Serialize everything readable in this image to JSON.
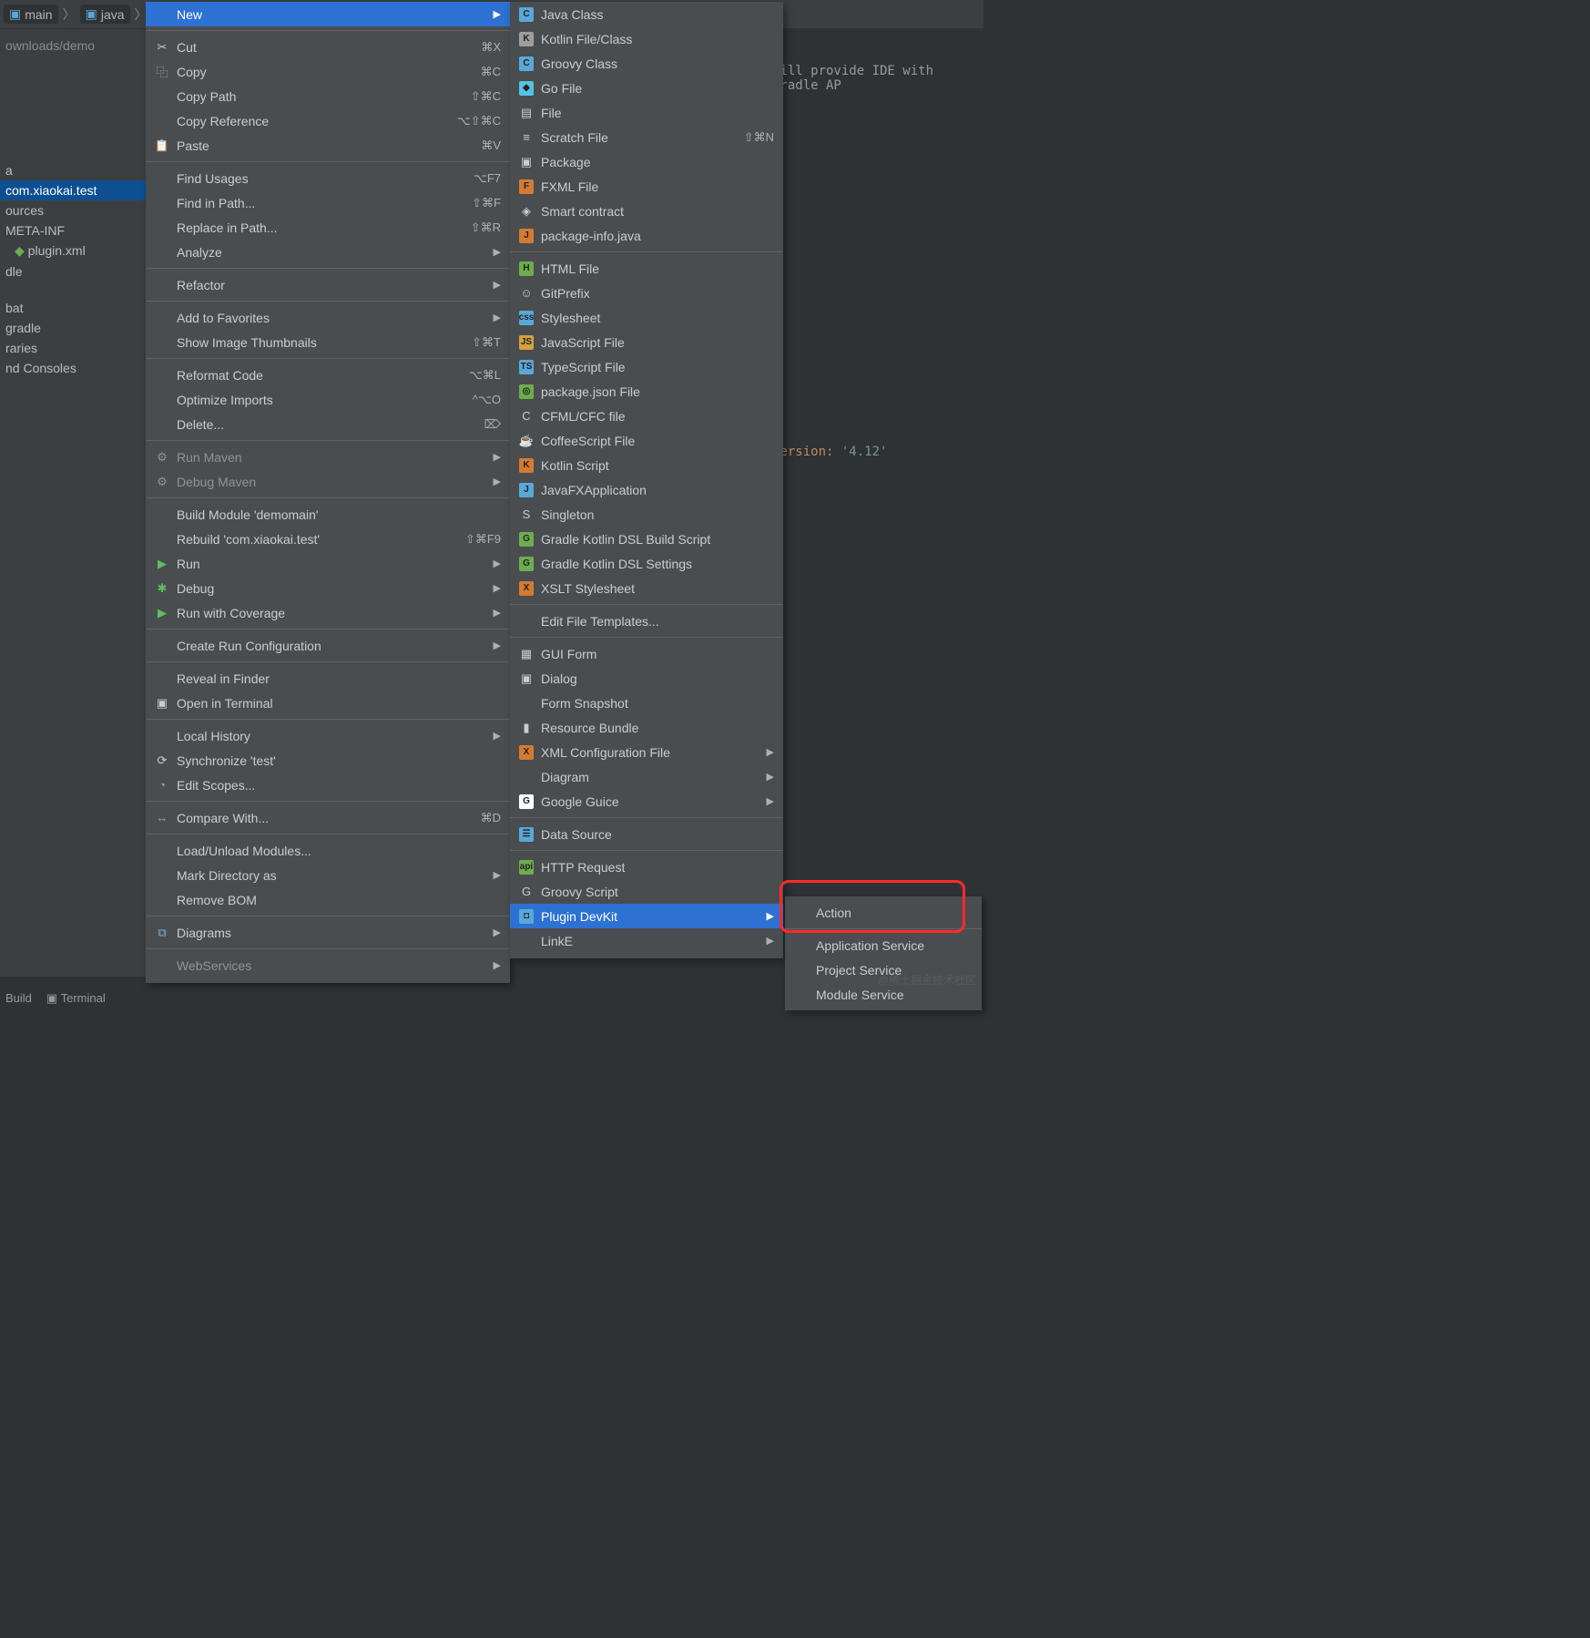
{
  "breadcrumb": {
    "items": [
      "main",
      "java",
      ""
    ]
  },
  "sidebarPath": "ownloads/demo",
  "sidebar": {
    "items": [
      {
        "label": "a"
      },
      {
        "label": "com.xiaokai.test",
        "selected": true
      },
      {
        "label": "ources"
      },
      {
        "label": "META-INF"
      },
      {
        "label": "plugin.xml",
        "indent": true
      },
      {
        "label": "dle"
      },
      {
        "label": ""
      },
      {
        "label": "bat"
      },
      {
        "label": "gradle"
      },
      {
        "label": "raries"
      },
      {
        "label": "nd Consoles"
      }
    ]
  },
  "contextMenu": [
    {
      "label": "New",
      "arrow": true,
      "selected": true
    },
    {
      "sep": true
    },
    {
      "icon": "✂",
      "label": "Cut",
      "sc": "⌘X"
    },
    {
      "icon": "⿻",
      "label": "Copy",
      "sc": "⌘C"
    },
    {
      "label": "Copy Path",
      "sc": "⇧⌘C"
    },
    {
      "label": "Copy Reference",
      "sc": "⌥⇧⌘C"
    },
    {
      "icon": "📋",
      "label": "Paste",
      "sc": "⌘V"
    },
    {
      "sep": true
    },
    {
      "label": "Find Usages",
      "sc": "⌥F7"
    },
    {
      "label": "Find in Path...",
      "sc": "⇧⌘F"
    },
    {
      "label": "Replace in Path...",
      "sc": "⇧⌘R"
    },
    {
      "label": "Analyze",
      "arrow": true
    },
    {
      "sep": true
    },
    {
      "label": "Refactor",
      "arrow": true
    },
    {
      "sep": true
    },
    {
      "label": "Add to Favorites",
      "arrow": true
    },
    {
      "label": "Show Image Thumbnails",
      "sc": "⇧⌘T"
    },
    {
      "sep": true
    },
    {
      "label": "Reformat Code",
      "sc": "⌥⌘L"
    },
    {
      "label": "Optimize Imports",
      "sc": "^⌥O"
    },
    {
      "label": "Delete...",
      "sc": "⌦"
    },
    {
      "sep": true
    },
    {
      "icon": "⚙",
      "label": "Run Maven",
      "arrow": true,
      "dim": true
    },
    {
      "icon": "⚙",
      "label": "Debug Maven",
      "arrow": true,
      "dim": true
    },
    {
      "sep": true
    },
    {
      "label": "Build Module 'demomain'"
    },
    {
      "label": "Rebuild 'com.xiaokai.test'",
      "sc": "⇧⌘F9"
    },
    {
      "icon": "▶",
      "label": "Run",
      "arrow": true,
      "iconColor": "#5fbf5f"
    },
    {
      "icon": "✱",
      "label": "Debug",
      "arrow": true,
      "iconColor": "#5fbf5f"
    },
    {
      "icon": "▶",
      "label": "Run with Coverage",
      "arrow": true,
      "iconColor": "#5fbf5f"
    },
    {
      "sep": true
    },
    {
      "label": "Create Run Configuration",
      "arrow": true
    },
    {
      "sep": true
    },
    {
      "label": "Reveal in Finder"
    },
    {
      "icon": "▣",
      "label": "Open in Terminal"
    },
    {
      "sep": true
    },
    {
      "label": "Local History",
      "arrow": true
    },
    {
      "icon": "⟳",
      "label": "Synchronize 'test'"
    },
    {
      "icon": "◔",
      "label": "Edit Scopes...",
      "iconColor": "#7eacdb"
    },
    {
      "sep": true
    },
    {
      "icon": "↔",
      "label": "Compare With...",
      "sc": "⌘D",
      "iconColor": "#7eacdb"
    },
    {
      "sep": true
    },
    {
      "label": "Load/Unload Modules..."
    },
    {
      "label": "Mark Directory as",
      "arrow": true
    },
    {
      "label": "Remove BOM"
    },
    {
      "sep": true
    },
    {
      "icon": "⧉",
      "label": "Diagrams",
      "arrow": true,
      "iconColor": "#7eacdb"
    },
    {
      "sep": true
    },
    {
      "label": "WebServices",
      "arrow": true,
      "dim": true
    }
  ],
  "newMenu": [
    {
      "icon": "C",
      "iconBg": "#5aa7d9",
      "label": "Java Class"
    },
    {
      "icon": "K",
      "iconBg": "#9e9e9e",
      "label": "Kotlin File/Class"
    },
    {
      "icon": "C",
      "iconBg": "#5aa7d9",
      "label": "Groovy Class"
    },
    {
      "icon": "◆",
      "iconBg": "#54c2e4",
      "label": "Go File"
    },
    {
      "icon": "▤",
      "label": "File"
    },
    {
      "icon": "≡",
      "label": "Scratch File",
      "sc": "⇧⌘N"
    },
    {
      "icon": "▣",
      "label": "Package"
    },
    {
      "icon": "F",
      "iconBg": "#d37b33",
      "label": "FXML File"
    },
    {
      "icon": "◈",
      "label": "Smart contract"
    },
    {
      "icon": "J",
      "iconBg": "#d37b33",
      "label": "package-info.java"
    },
    {
      "sep": true
    },
    {
      "icon": "H",
      "iconBg": "#6dad4f",
      "label": "HTML File"
    },
    {
      "icon": "☺",
      "label": "GitPrefix"
    },
    {
      "icon": "css",
      "iconBg": "#5aa7d9",
      "label": "Stylesheet"
    },
    {
      "icon": "JS",
      "iconBg": "#d3a33e",
      "label": "JavaScript File"
    },
    {
      "icon": "TS",
      "iconBg": "#5aa7d9",
      "label": "TypeScript File"
    },
    {
      "icon": "◎",
      "iconBg": "#6dad4f",
      "label": "package.json File"
    },
    {
      "icon": "C",
      "label": "CFML/CFC file"
    },
    {
      "icon": "☕",
      "label": "CoffeeScript File"
    },
    {
      "icon": "K",
      "iconBg": "#d37b33",
      "label": "Kotlin Script"
    },
    {
      "icon": "J",
      "iconBg": "#5aa7d9",
      "label": "JavaFXApplication"
    },
    {
      "icon": "S",
      "label": "Singleton"
    },
    {
      "icon": "G",
      "iconBg": "#6dad4f",
      "label": "Gradle Kotlin DSL Build Script"
    },
    {
      "icon": "G",
      "iconBg": "#6dad4f",
      "label": "Gradle Kotlin DSL Settings"
    },
    {
      "icon": "X",
      "iconBg": "#d37b33",
      "label": "XSLT Stylesheet"
    },
    {
      "sep": true
    },
    {
      "label": "Edit File Templates..."
    },
    {
      "sep": true
    },
    {
      "icon": "▦",
      "label": "GUI Form"
    },
    {
      "icon": "▣",
      "label": "Dialog"
    },
    {
      "label": "Form Snapshot"
    },
    {
      "icon": "▮",
      "label": "Resource Bundle"
    },
    {
      "icon": "X",
      "iconBg": "#d37b33",
      "label": "XML Configuration File",
      "arrow": true
    },
    {
      "label": "Diagram",
      "arrow": true
    },
    {
      "icon": "G",
      "iconBg": "#fff",
      "label": "Google Guice",
      "arrow": true
    },
    {
      "sep": true
    },
    {
      "icon": "☰",
      "iconBg": "#5aa7d9",
      "label": "Data Source"
    },
    {
      "sep": true
    },
    {
      "icon": "api",
      "iconBg": "#6dad4f",
      "label": "HTTP Request"
    },
    {
      "icon": "G",
      "label": "Groovy Script"
    },
    {
      "icon": "◘",
      "iconBg": "#5aa7d9",
      "label": "Plugin DevKit",
      "arrow": true,
      "selected": true
    },
    {
      "label": "LinkE",
      "arrow": true
    }
  ],
  "pluginMenu": [
    {
      "label": "Action",
      "highlight": true
    },
    {
      "sep": true
    },
    {
      "label": "Application Service"
    },
    {
      "label": "Project Service"
    },
    {
      "label": "Module Service"
    }
  ],
  "editorSnippet": {
    "line1": "will provide IDE with Gradle AP",
    "line2": "version:",
    "ver": "'4.12'"
  },
  "bottomTabs": [
    "Build",
    "Terminal"
  ],
  "watermark": "@稀土掘金技术社区"
}
